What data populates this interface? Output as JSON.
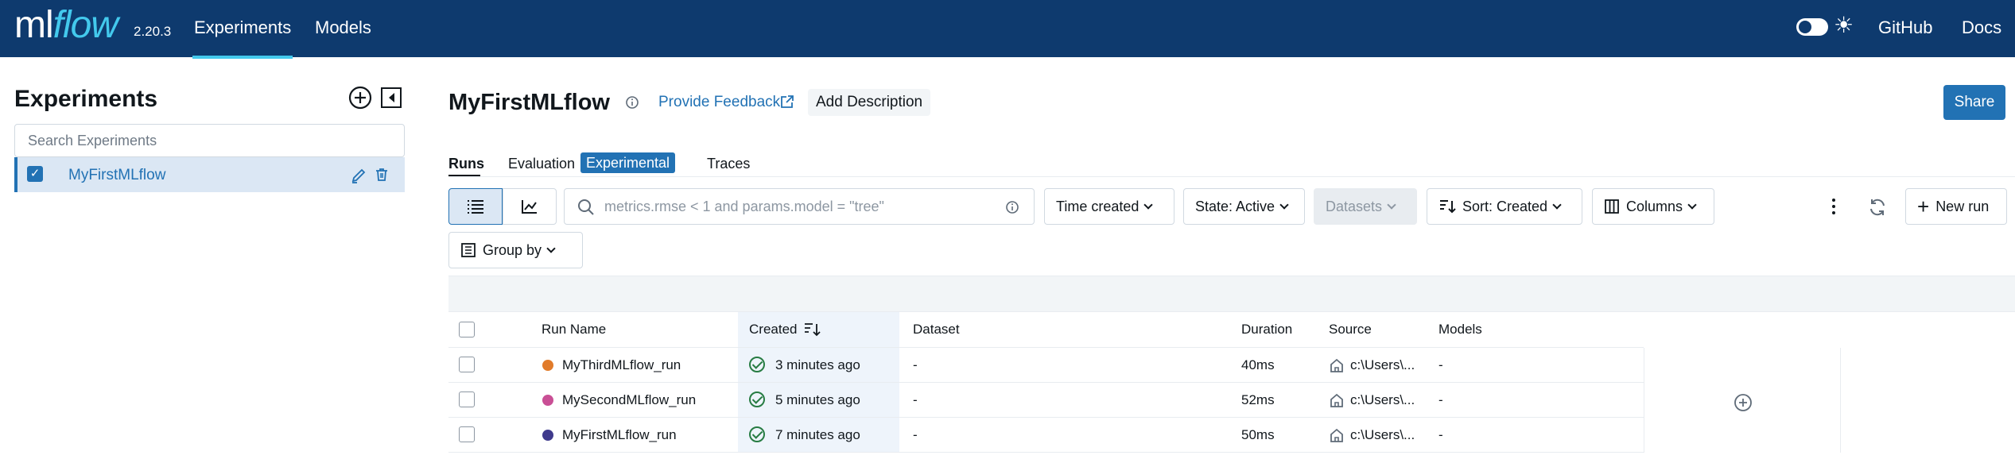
{
  "topbar": {
    "logo_ml": "ml",
    "logo_flow": "flow",
    "version": "2.20.3",
    "nav": [
      "Experiments",
      "Models"
    ],
    "links": [
      "GitHub",
      "Docs"
    ],
    "accent": "#43c9ed",
    "background": "#0e3a6e"
  },
  "sidebar": {
    "title": "Experiments",
    "search_placeholder": "Search Experiments",
    "items": [
      {
        "label": "MyFirstMLflow",
        "checked": true
      }
    ]
  },
  "main": {
    "title": "MyFirstMLflow",
    "provide_feedback": "Provide Feedback",
    "add_description": "Add Description",
    "share": "Share",
    "tabs": [
      "Runs",
      "Evaluation",
      "Traces"
    ],
    "experimental_badge": "Experimental",
    "search_placeholder": "metrics.rmse < 1 and params.model = \"tree\"",
    "time_created": "Time created",
    "state": "State: Active",
    "datasets": "Datasets",
    "sort": "Sort: Created",
    "columns": "Columns",
    "new_run": "New run",
    "group_by": "Group by"
  },
  "table": {
    "headers": [
      "Run Name",
      "Created",
      "Dataset",
      "Duration",
      "Source",
      "Models"
    ],
    "rows": [
      {
        "name": "MyThirdMLflow_run",
        "color": "#e17b2a",
        "created": "3 minutes ago",
        "dataset": "-",
        "duration": "40ms",
        "source": "c:\\Users\\...",
        "models": "-"
      },
      {
        "name": "MySecondMLflow_run",
        "color": "#c94f95",
        "created": "5 minutes ago",
        "dataset": "-",
        "duration": "52ms",
        "source": "c:\\Users\\...",
        "models": "-"
      },
      {
        "name": "MyFirstMLflow_run",
        "color": "#3f3a8c",
        "created": "7 minutes ago",
        "dataset": "-",
        "duration": "50ms",
        "source": "c:\\Users\\...",
        "models": "-"
      }
    ]
  },
  "colors": {
    "primary": "#2272b4",
    "success": "#277c43"
  }
}
